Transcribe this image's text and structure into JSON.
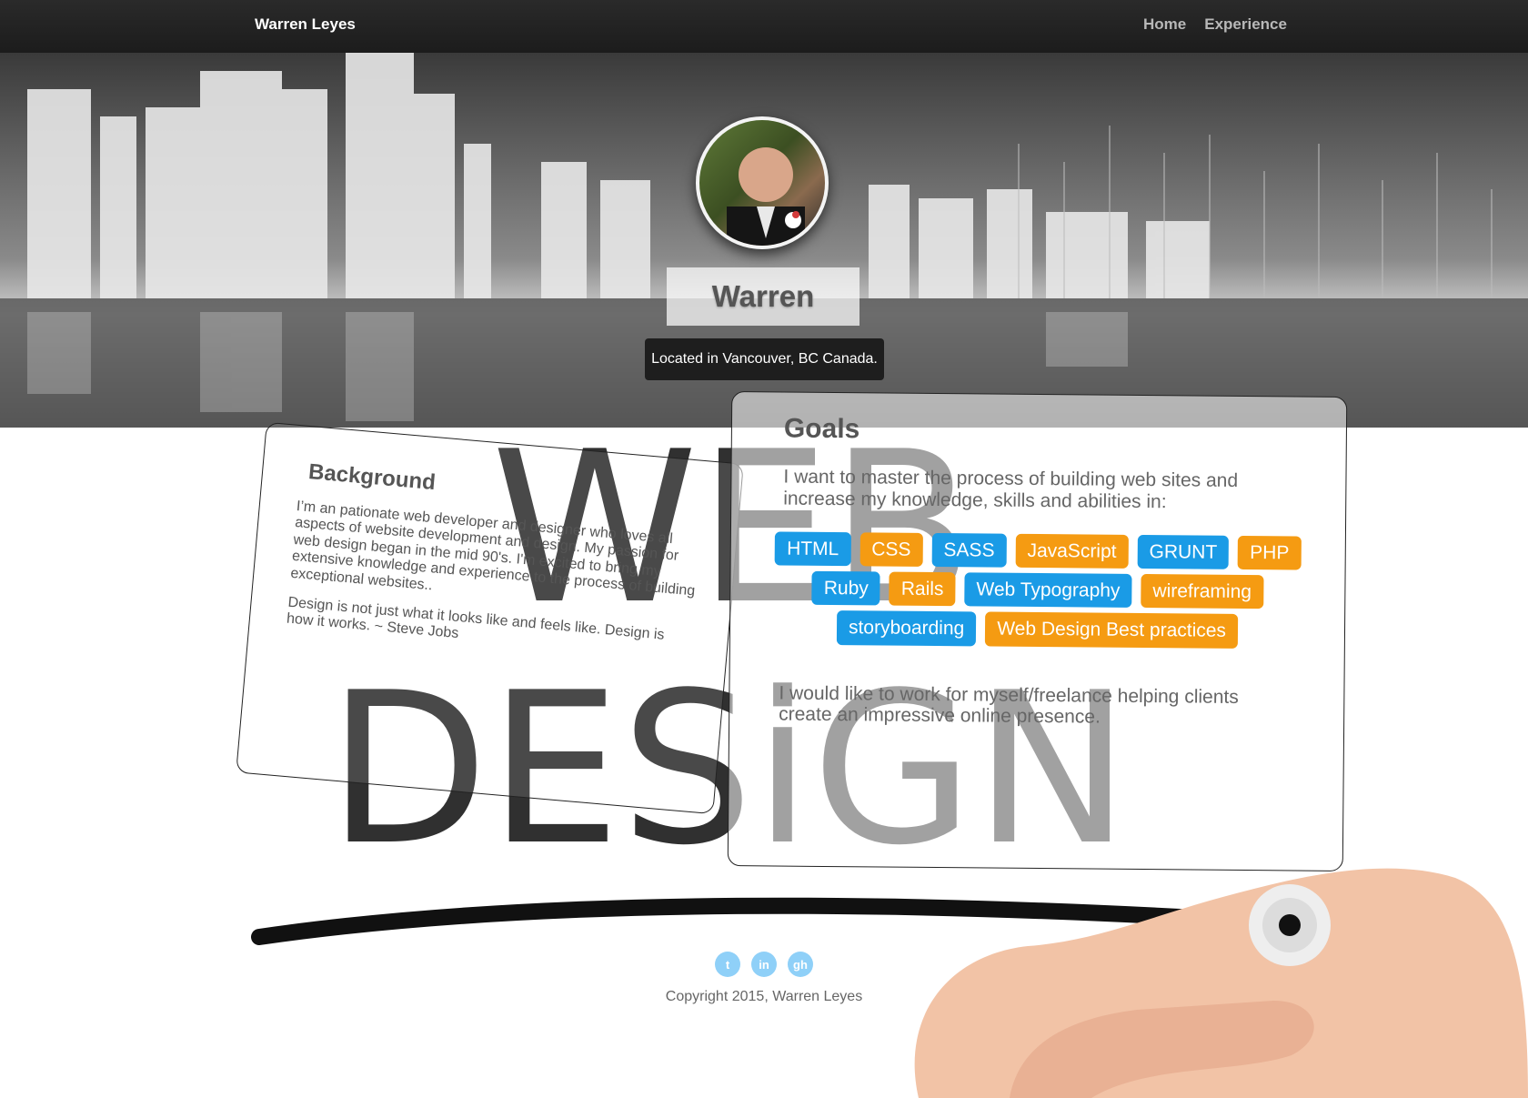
{
  "nav": {
    "brand": "Warren Leyes",
    "links": [
      "Home",
      "Experience"
    ]
  },
  "hero": {
    "name": "Warren Leyes",
    "location": "Located in Vancouver, BC Canada."
  },
  "background": {
    "title": "Background",
    "para1": "I’m an pationate web developer and designer who loves all aspects of website development and design. My passion for web design began in the mid 90's. I'm excited to bring my extensive knowledge and experience to the process of building exceptional websites..",
    "para2": "Design is not just what it looks like and feels like. Design is how it works. ~ Steve Jobs"
  },
  "goals": {
    "title": "Goals",
    "intro": "I want to master the process of building web sites and increase my knowledge, skills and abilities in:",
    "tags": [
      {
        "label": "HTML",
        "color": "#1a9be6"
      },
      {
        "label": "CSS",
        "color": "#f59b12"
      },
      {
        "label": "SASS",
        "color": "#1a9be6"
      },
      {
        "label": "JavaScript",
        "color": "#f59b12"
      },
      {
        "label": "GRUNT",
        "color": "#1a9be6"
      },
      {
        "label": "PHP",
        "color": "#f59b12"
      },
      {
        "label": "Ruby",
        "color": "#1a9be6"
      },
      {
        "label": "Rails",
        "color": "#f59b12"
      },
      {
        "label": "Web Typography",
        "color": "#1a9be6"
      },
      {
        "label": "wireframing",
        "color": "#f59b12"
      },
      {
        "label": "storyboarding",
        "color": "#1a9be6"
      },
      {
        "label": "Web Design Best practices",
        "color": "#f59b12"
      }
    ],
    "outro": "I would like to work for myself/freelance helping clients create an impressive online presence."
  },
  "art": {
    "line1": "WEB",
    "line2": "DESiGN"
  },
  "footer": {
    "social": [
      {
        "icon": "twitter-icon",
        "glyph": "t"
      },
      {
        "icon": "linkedin-icon",
        "glyph": "in"
      },
      {
        "icon": "github-icon",
        "glyph": "gh"
      }
    ],
    "copyright": "Copyright 2015, Warren Leyes"
  }
}
